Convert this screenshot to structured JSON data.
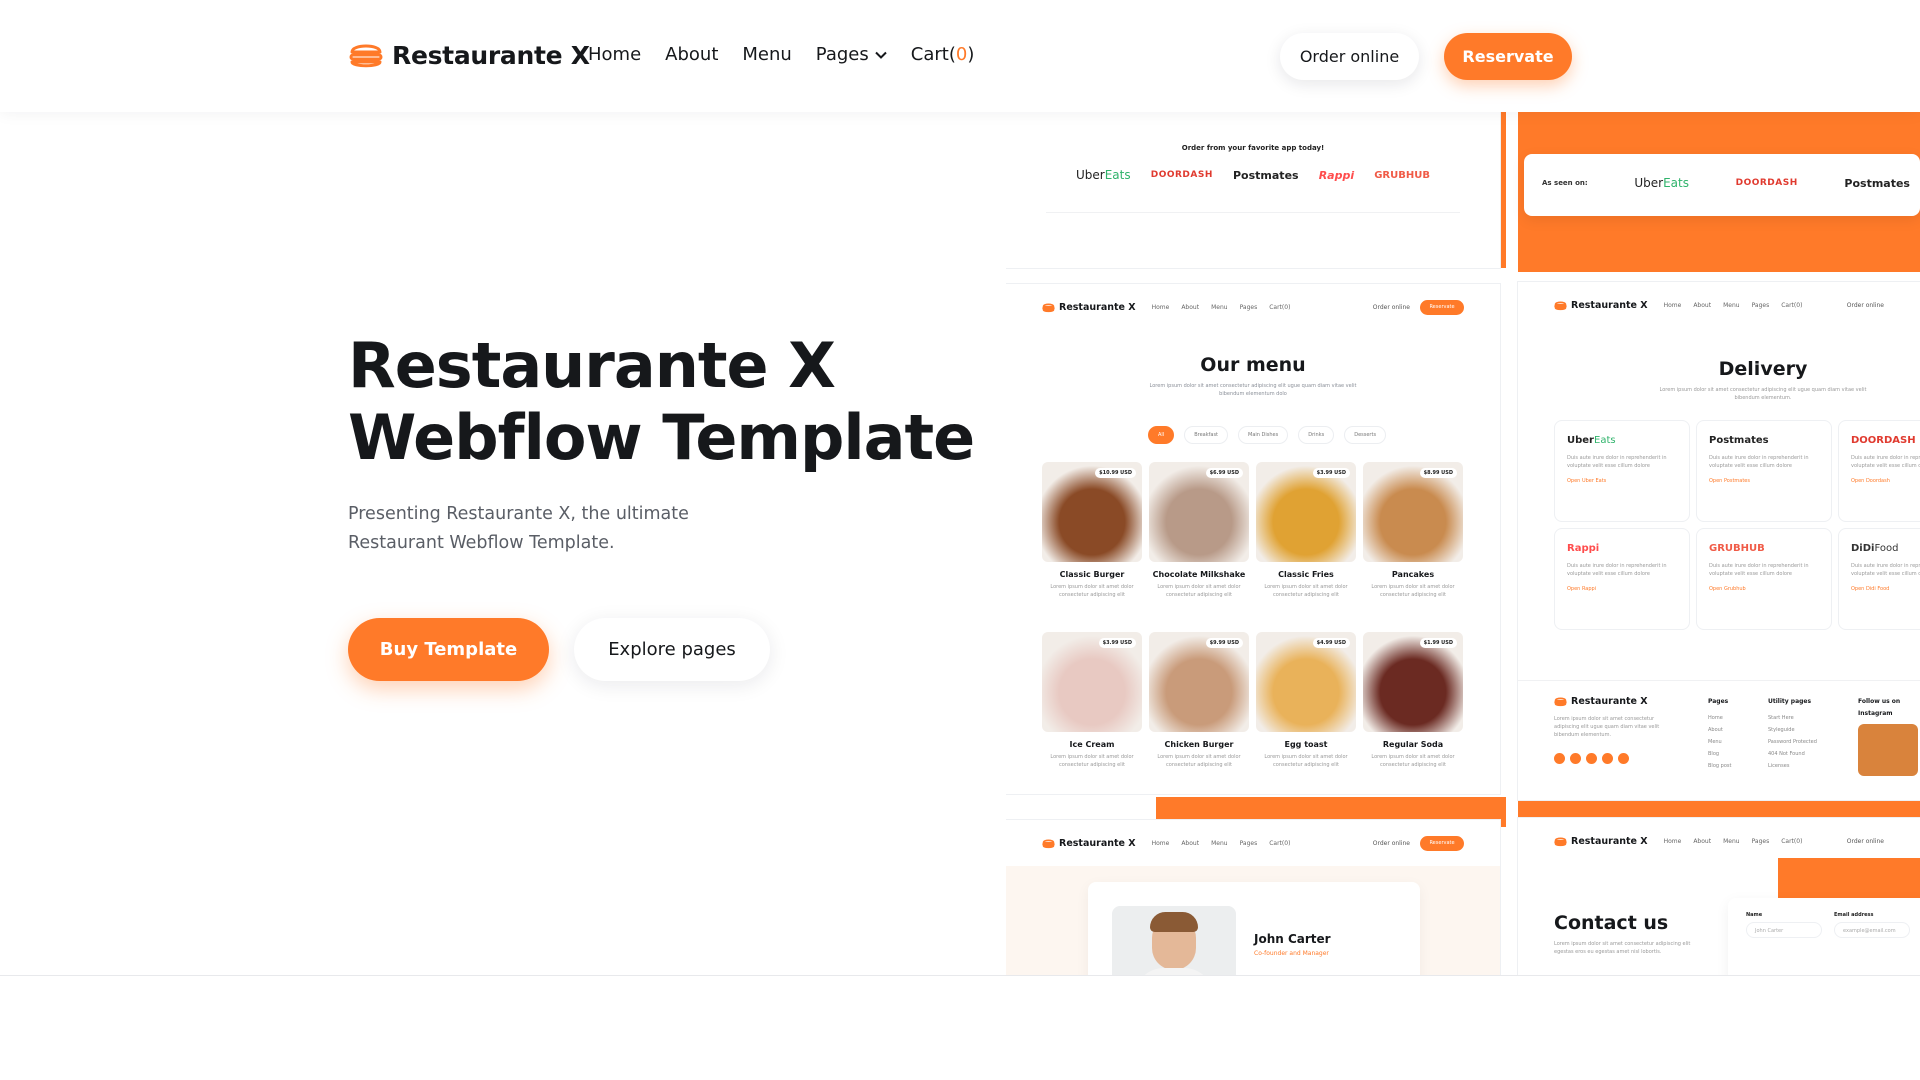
{
  "nav": {
    "brand": "Restaurante X",
    "links": [
      "Home",
      "About",
      "Menu"
    ],
    "pages_label": "Pages",
    "cart_label": "Cart",
    "cart_open": "(",
    "cart_count": "0",
    "cart_close": ")",
    "order_online": "Order online",
    "reservate": "Reservate"
  },
  "hero": {
    "title_line1": "Restaurante X",
    "title_line2": "Webflow Template",
    "description": "Presenting Restaurante X, the ultimate Restaurant Webflow Template.",
    "buy_button": "Buy Template",
    "explore_button": "Explore pages"
  },
  "showcase": {
    "order_app": {
      "heading": "Order from your favorite app today!",
      "uber": "Uber",
      "eats": "Eats",
      "doordash": "DOORDASH",
      "postmates": "Postmates",
      "rappi": "Rappi",
      "grubhub": "GRUBHUB"
    },
    "as_seen": {
      "label": "As seen on:",
      "uber": "Uber",
      "eats": "Eats",
      "doordash": "DOORDASH",
      "postmates": "Postmates"
    },
    "mini_nav": {
      "brand": "Restaurante X",
      "links": [
        "Home",
        "About",
        "Menu",
        "Pages",
        "Cart(0)"
      ],
      "order": "Order online",
      "reservate": "Reservate"
    },
    "menu_page": {
      "title": "Our menu",
      "subtitle": "Lorem ipsum dolor sit amet consectetur adipiscing elit ugue quam diam vitae velit bibendum elementum dolo",
      "filters": [
        "All",
        "Breakfast",
        "Main Dishes",
        "Drinks",
        "Desserts"
      ],
      "items": [
        {
          "name": "Classic Burger",
          "price": "$10.99 USD",
          "color": "#8a4a26"
        },
        {
          "name": "Chocolate Milkshake",
          "price": "$6.99 USD",
          "color": "#b89a88"
        },
        {
          "name": "Classic Fries",
          "price": "$3.99 USD",
          "color": "#e0a233"
        },
        {
          "name": "Pancakes",
          "price": "$8.99 USD",
          "color": "#c98b4f"
        },
        {
          "name": "Ice Cream",
          "price": "$3.99 USD",
          "color": "#e8c9c2"
        },
        {
          "name": "Chicken Burger",
          "price": "$9.99 USD",
          "color": "#c99b7a"
        },
        {
          "name": "Egg toast",
          "price": "$4.99 USD",
          "color": "#e9b25a"
        },
        {
          "name": "Regular Soda",
          "price": "$1.99 USD",
          "color": "#6b2a22"
        }
      ],
      "item_desc": "Lorem ipsum dolor sit amet dolor consectetur adipiscing elit"
    },
    "delivery_page": {
      "title": "Delivery",
      "subtitle": "Lorem ipsum dolor sit amet consectetur adipiscing elit ugue quam diam vitae velit bibendum elementum.",
      "card_desc": "Duis aute irure dolor in reprehenderit in voluptate velit esse cillum dolore",
      "cards": [
        {
          "brand_a": "Uber",
          "brand_b": "Eats",
          "link": "Open Uber Eats"
        },
        {
          "brand_a": "Postmates",
          "brand_b": "",
          "link": "Open Postmates"
        },
        {
          "brand_a": "DOORDASH",
          "brand_b": "",
          "link": "Open Doordash"
        },
        {
          "brand_a": "Rappi",
          "brand_b": "",
          "link": "Open Rappi"
        },
        {
          "brand_a": "GRUBHUB",
          "brand_b": "",
          "link": "Open Grubhub"
        },
        {
          "brand_a": "DiDi",
          "brand_b": "Food",
          "link": "Open Didi Food"
        }
      ]
    },
    "footer_page": {
      "brand": "Restaurante X",
      "desc": "Lorem ipsum dolor sit amet consectetur adipiscing elit ugue quam diam vitae velit bibendum elementum.",
      "pages_heading": "Pages",
      "pages": [
        "Home",
        "About",
        "Menu",
        "Blog",
        "Blog post"
      ],
      "utility_heading": "Utility pages",
      "utility": [
        "Start Here",
        "Styleguide",
        "Password Protected",
        "404 Not Found",
        "Licenses"
      ],
      "insta_heading": "Follow us on Instagram"
    },
    "about_page": {
      "name": "John Carter",
      "role": "Co-founder and Manager"
    },
    "contact_page": {
      "title": "Contact us",
      "desc": "Lorem ipsum dolor sit amet consectetur adipiscing elit egestas eros eu egestas amet nisl lobortis.",
      "name_label": "Name",
      "name_placeholder": "John Carter",
      "email_label": "Email address",
      "email_placeholder": "example@email.com"
    }
  },
  "colors": {
    "accent": "#ff7a29",
    "text": "#16181b",
    "muted": "#5a5e66"
  }
}
